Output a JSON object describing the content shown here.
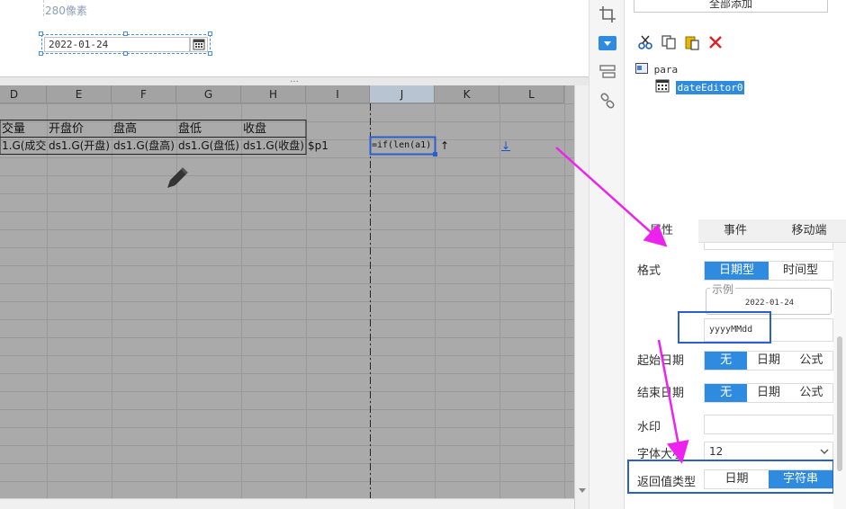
{
  "param_panel": {
    "width_label": "280像素",
    "date_editor_value": "2022-01-24",
    "resize_grip": "..."
  },
  "sheet": {
    "columns": [
      "D",
      "E",
      "F",
      "G",
      "H",
      "I",
      "J",
      "K",
      "L"
    ],
    "header_row": [
      "交量",
      "开盘价",
      "盘高",
      "盘低",
      "收盘"
    ],
    "data_row": [
      "1.G(成交",
      "ds1.G(开盘)",
      "ds1.G(盘高)",
      "ds1.G(盘低)",
      "ds1.G(收盘)",
      "$p1",
      "=if(len(a1)",
      "↑",
      "↓"
    ]
  },
  "toolbar": {
    "icons": [
      "crop-icon",
      "dropdown-widget-icon",
      "list-layout-icon",
      "link-icon"
    ]
  },
  "right_panel": {
    "add_all_label": "全部添加",
    "tree_tools": [
      "cut-icon",
      "copy-icon",
      "paste-icon",
      "delete-icon"
    ],
    "tree_root": "para",
    "tree_child": "dateEditor0",
    "tabs": [
      "属性",
      "事件",
      "移动端"
    ],
    "props": {
      "format_label": "格式",
      "format_options": [
        "日期型",
        "时间型"
      ],
      "example_legend": "示例",
      "example_value": "2022-01-24",
      "pattern_value": "yyyyMMdd",
      "start_date_label": "起始日期",
      "end_date_label": "结束日期",
      "date_options": [
        "无",
        "日期",
        "公式"
      ],
      "watermark_label": "水印",
      "watermark_value": "",
      "font_size_label": "字体大小",
      "font_size_value": "12",
      "return_type_label": "返回值类型",
      "return_options": [
        "日期",
        "字符串"
      ]
    }
  },
  "colors": {
    "accent": "#2f8be0",
    "highlight_box": "#2b5fcf",
    "annotation_arrow": "#ee22ee",
    "sheet_bg": "#aaaaaa"
  }
}
